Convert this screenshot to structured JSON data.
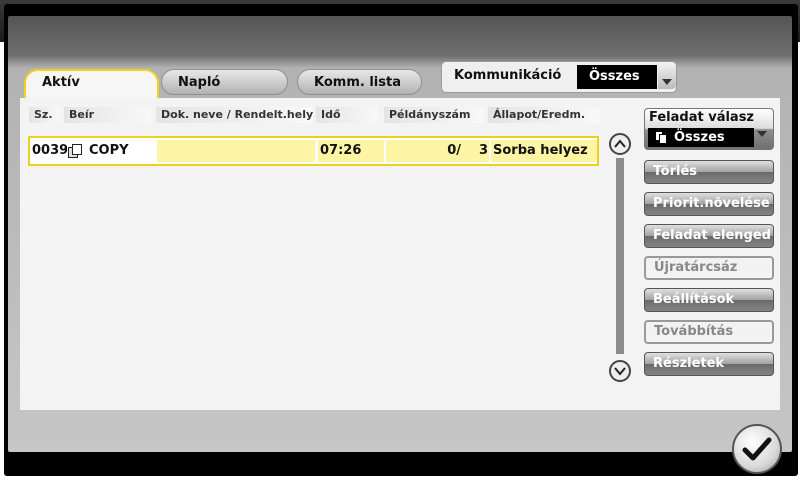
{
  "tabs": [
    {
      "label": "Aktív",
      "active": true
    },
    {
      "label": "Napló",
      "active": false
    },
    {
      "label": "Komm. lista",
      "active": false
    }
  ],
  "communication": {
    "label": "Kommunikáció",
    "value": "Összes"
  },
  "columns": [
    "Sz.",
    "Beír",
    "Dok. neve / Rendelt.hely",
    "Idő",
    "Példányszám",
    "Állapot/Eredm."
  ],
  "rows": [
    {
      "number": "0039",
      "name": "COPY",
      "time": "07:26",
      "copies": "0/",
      "total": "3",
      "status": "Sorba helyez"
    }
  ],
  "job_select": {
    "label": "Feladat válasz",
    "value": "Összes"
  },
  "actions": [
    {
      "label": "Törlés",
      "enabled": true
    },
    {
      "label": "Priorit.növelése",
      "enabled": true
    },
    {
      "label": "Feladat elenged",
      "enabled": true
    },
    {
      "label": "Újratárcsáz",
      "enabled": false
    },
    {
      "label": "Beállítások",
      "enabled": true
    },
    {
      "label": "Továbbítás",
      "enabled": false
    },
    {
      "label": "Részletek",
      "enabled": true
    }
  ],
  "colors": {
    "accent": "#f5d21a",
    "row_highlight": "#fdf5a3",
    "button_dark": "#6a6a6a"
  },
  "icons": {
    "copy_job": "copy-job-icon",
    "scroll_up": "chevron-up-icon",
    "scroll_down": "chevron-down-icon",
    "confirm": "checkmark-icon"
  }
}
